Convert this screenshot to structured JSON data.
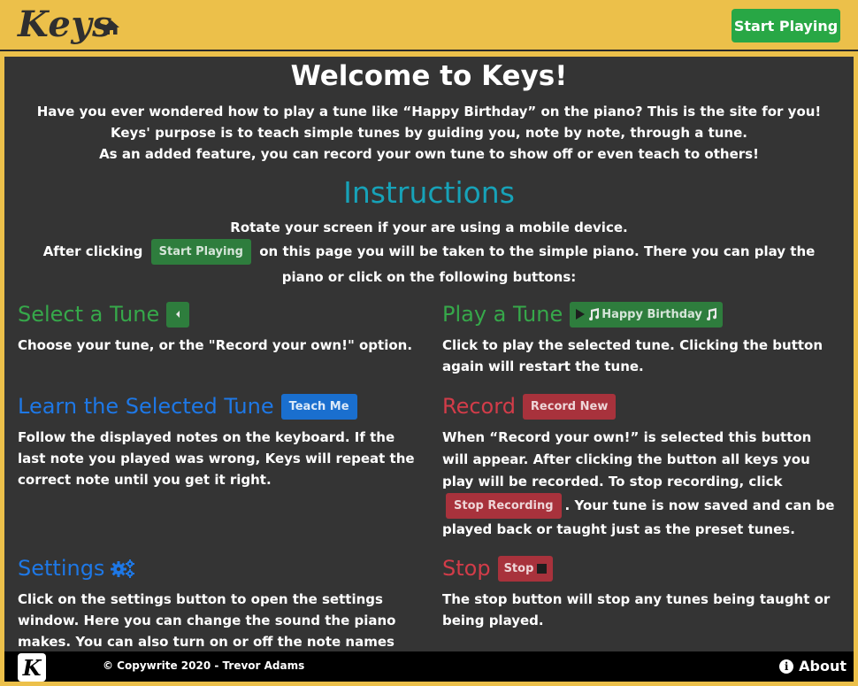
{
  "navbar": {
    "brand": "Keys",
    "start_label": "Start Playing"
  },
  "welcome": {
    "title": "Welcome to Keys!",
    "lines": [
      "Have you ever wondered how to play a tune like “Happy Birthday” on the piano? This is the site for you!",
      "Keys' purpose is to teach simple tunes by guiding you, note by note, through a tune.",
      "As an added feature, you can record your own tune to show off or even teach to others!"
    ]
  },
  "instructions": {
    "title": "Instructions",
    "rotate": "Rotate your screen if your are using a mobile device.",
    "after_prefix": "After clicking",
    "after_button": "Start Playing",
    "after_suffix": "on this page you will be taken to the simple piano. There you can play the piano or click on the following buttons:"
  },
  "sections": {
    "select": {
      "title": "Select a Tune",
      "body": "Choose your tune, or the \"Record your own!\" option."
    },
    "play": {
      "title": "Play a Tune",
      "button": "Happy Birthday",
      "body": "Click to play the selected tune. Clicking the button again will restart the tune."
    },
    "learn": {
      "title": "Learn the Selected Tune",
      "button": "Teach Me",
      "body": "Follow the displayed notes on the keyboard. If the last note you played was wrong, Keys will repeat the correct note until you get it right."
    },
    "record": {
      "title": "Record",
      "button": "Record New",
      "body_prefix": "When “Record your own!” is selected this button will appear. After clicking the button all keys you play will be recorded. To stop recording, click",
      "inline_button": "Stop Recording",
      "body_suffix": ". Your tune is now saved and can be played back or taught just as the preset tunes."
    },
    "settings": {
      "title": "Settings",
      "body": "Click on the settings button to open the settings window. Here you can change the sound the piano makes. You can also turn on or off the note names on the piano."
    },
    "stop": {
      "title": "Stop",
      "button": "Stop",
      "body": "The stop button will stop any tunes being taught or being played."
    }
  },
  "footer": {
    "logo_letter": "K",
    "copyright": "© Copywrite 2020 - Trevor Adams",
    "about_label": "About"
  },
  "colors": {
    "navbar_bg": "#ecc04a",
    "panel_bg": "#343434",
    "green": "#36a84a",
    "blue": "#1e78e6",
    "red": "#d23c49",
    "teal": "#17a2b8"
  },
  "icons": [
    "home-icon",
    "caret-left-icon",
    "play-icon",
    "music-note-icon",
    "gears-icon",
    "stop-square-icon",
    "info-icon"
  ]
}
